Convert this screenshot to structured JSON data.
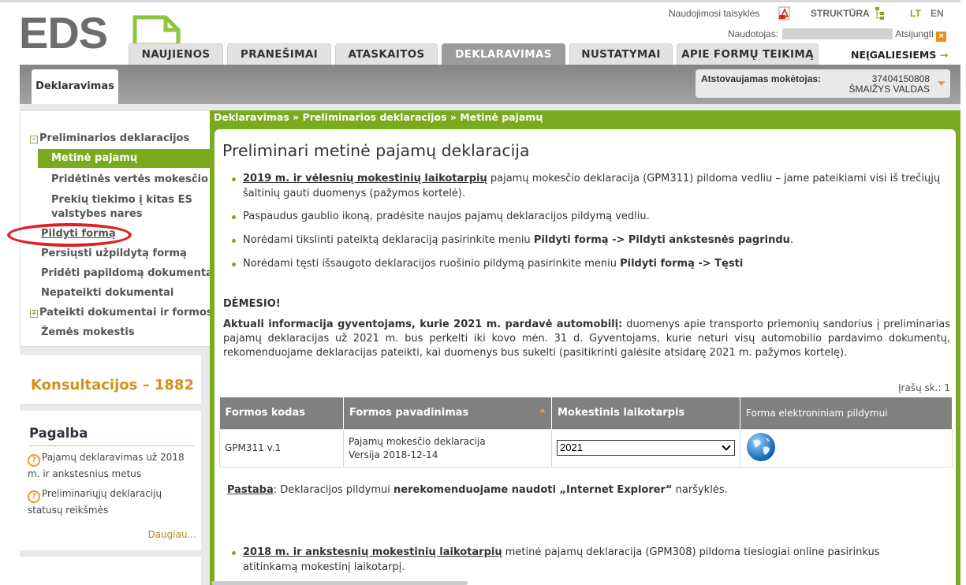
{
  "header": {
    "logo_text": "EDS",
    "links": {
      "terms": "Naudojimosi taisyklės",
      "structure": "STRUKTŪRA",
      "lang_lt": "LT",
      "lang_en": "EN"
    },
    "user_label": "Naudotojas:",
    "logout": "Atsijungti",
    "tabs": [
      "NAUJIENOS",
      "PRANEŠIMAI",
      "ATASKAITOS",
      "DEKLARAVIMAS",
      "NUSTATYMAI",
      "APIE FORMŲ TEIKIMĄ"
    ],
    "disabled_link": "NEĮGALIESIEMS",
    "active_tab": "DEKLARAVIMAS"
  },
  "subnav": {
    "tab": "Deklaravimas",
    "payer_label": "Atstovaujamas mokėtojas:",
    "payer_code": "37404150808",
    "payer_name": "ŠMAIŽYS VALDAS"
  },
  "sidebar": {
    "group": "Preliminarios deklaracijos",
    "items": [
      "Metinė pajamų",
      "Pridėtinės vertės mokesčio",
      "Prekių tiekimo į kitas ES valstybes nares"
    ],
    "links": [
      "Pildyti formą",
      "Persiųsti užpildytą formą",
      "Pridėti papildomą dokumentą",
      "Nepateikti dokumentai",
      "Pateikti dokumentai ir formos",
      "Žemės mokestis"
    ]
  },
  "consult": "Konsultacijos – 1882",
  "help": {
    "title": "Pagalba",
    "items": [
      "Pajamų deklaravimas už 2018 m. ir ankstesnius metus",
      "Preliminariųjų deklaracijų statusų reikšmės"
    ],
    "more": "Daugiau..."
  },
  "main": {
    "breadcrumb": "Deklaravimas »  Preliminarios deklaracijos  » Metinė pajamų",
    "title": "Preliminari metinė pajamų deklaracija",
    "b1_link": "2019 m. ir vėlesnių mokestinių laikotarpių",
    "b1_text": " pajamų mokesčio deklaracija (GPM311) pildoma vedliu – jame pateikiami visi iš trečiųjų šaltinių gauti duomenys (pažymos kortelė).",
    "b2_text": "Paspaudus gaublio ikoną, pradėsite naujos pajamų deklaracijos pildymą vedliu.",
    "b3_text": "Norėdami tikslinti pateiktą deklaraciją pasirinkite meniu ",
    "b3_bold": "Pildyti formą -> Pildyti ankstesnės pagrindu",
    "b3_end": ".",
    "b4_text": "Norėdami tęsti išsaugoto deklaracijos ruošinio pildymą pasirinkite meniu ",
    "b4_bold": "Pildyti formą -> Tęsti",
    "attention": "DĖMESIO!",
    "info_bold": "Aktuali informacija gyventojams, kurie 2021 m. pardavė automobilį:",
    "info_text": " duomenys apie transporto priemonių sandorius į preliminarias pajamų deklaracijas už 2021 m. bus perkelti iki kovo mėn. 31 d. Gyventojams, kurie neturi visų automobilio pardavimo dokumentų, rekomenduojame deklaracijas pateikti, kai duomenys bus sukelti (pasitikrinti galėsite atsidarę 2021 m. pažymos kortelę).",
    "records": "Įrašų sk.: 1",
    "table": {
      "headers": [
        "Formos kodas",
        "Formos pavadinimas",
        "Mokestinis laikotarpis",
        "Forma elektroniniam pildymui"
      ],
      "row": {
        "code": "GPM311 v.1",
        "name1": "Pajamų mokesčio deklaracija",
        "name2": "Versija 2018-12-14",
        "period": "2021"
      }
    },
    "note_label": "Pastaba",
    "note_text": ": Deklaracijos pildymui ",
    "note_bold": "nerekomenduojame naudoti „Internet Explorer“",
    "note_end": " naršyklės.",
    "b5_link": "2018 m. ir ankstesnių mokestinių laikotarpių",
    "b5_text": " metinė pajamų deklaracija (GPM308) pildoma tiesiogiai online pasirinkus atitinkamą mokestinį laikotarpį."
  },
  "colors": {
    "accent": "#7aab1e",
    "tab_active": "#9c9c9c",
    "highlight": "#e01f26"
  }
}
